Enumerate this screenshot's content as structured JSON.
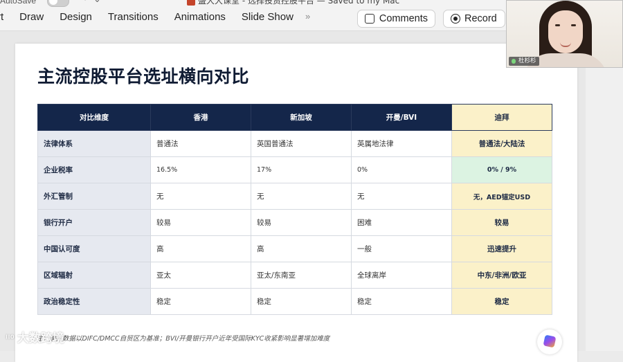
{
  "app": {
    "autosave_label": "AutoSave",
    "quick_access": "↶ ⌄",
    "doc_title": "盛大大课堂 - 选择投资控股平台 — Saved to my Mac",
    "tabs": [
      "rt",
      "Draw",
      "Design",
      "Transitions",
      "Animations",
      "Slide Show"
    ],
    "tabs_overflow": "»",
    "comments_label": "Comments",
    "record_label": "Record"
  },
  "webcam": {
    "participant_name": "杜杉杉"
  },
  "slide": {
    "title": "主流控股平台选址横向对比",
    "table": {
      "headers": [
        "对比维度",
        "香港",
        "新加坡",
        "开曼/BVI",
        "迪拜"
      ],
      "rows": [
        [
          "法律体系",
          "普通法",
          "英国普通法",
          "英属地法律",
          "普通法/大陆法"
        ],
        [
          "企业税率",
          "16.5%",
          "17%",
          "0%",
          "0% / 9%"
        ],
        [
          "外汇管制",
          "无",
          "无",
          "无",
          "无，AED锚定USD"
        ],
        [
          "银行开户",
          "较易",
          "较易",
          "困难",
          "较易"
        ],
        [
          "中国认可度",
          "高",
          "高",
          "一般",
          "迅速提升"
        ],
        [
          "区域辐射",
          "亚太",
          "亚太/东南亚",
          "全球离岸",
          "中东/非洲/欧亚"
        ],
        [
          "政治稳定性",
          "稳定",
          "稳定",
          "稳定",
          "稳定"
        ]
      ]
    },
    "footnote": "注：迪拜数据以DIFC/DMCC自贸区为基准；BVI/开曼银行开户近年受国际KYC收紧影响显著增加难度"
  },
  "watermark": {
    "text": "大数跨境"
  },
  "colors": {
    "header_navy": "#14264a",
    "dubai_highlight": "#fbf1c9",
    "tax_highlight": "#dcf3e2",
    "dimension_bg": "#e6e9f0"
  }
}
